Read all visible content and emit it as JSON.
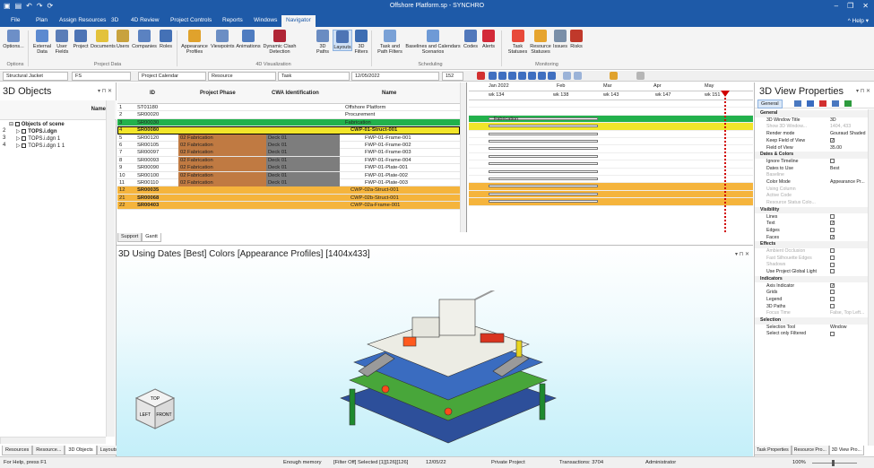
{
  "app": {
    "title": "Offshore Platform.sp - SYNCHRO"
  },
  "menu": {
    "items": [
      "File",
      "Plan",
      "Assign Resources",
      "3D",
      "4D Review",
      "Project Controls",
      "Reports",
      "Windows",
      "Navigator"
    ],
    "active": "Navigator",
    "help": "^ Help ▾"
  },
  "ribbon": {
    "buttons": [
      "Options...",
      "External Data",
      "User Fields",
      "Project",
      "Documents",
      "Users",
      "Companies",
      "Roles",
      "Appearance Profiles",
      "Viewpoints",
      "Animations",
      "Dynamic Clash Detection",
      "3D Paths",
      "Layouts",
      "3D Filters",
      "Task and Path Filters",
      "Baselines and Calendars Scenarios",
      "Codes",
      "Alerts",
      "Task Statuses",
      "Resource Statuses",
      "Issues",
      "Risks"
    ],
    "groups": [
      "Options",
      "Project Data",
      "4D Visualization",
      "Scheduling",
      "Monitoring"
    ]
  },
  "filters": {
    "structure": "Structural Jacket",
    "fs": "FS",
    "calendar": "Project Calendar",
    "resource": "Resource",
    "task": "Task",
    "date": "12/05/2022",
    "zoom": "152"
  },
  "left_panel": {
    "title": "3D Objects",
    "col": "Name",
    "rows": [
      {
        "num": "",
        "name": "Objects of scene"
      },
      {
        "num": "2",
        "name": "TOPS.i.dgn"
      },
      {
        "num": "3",
        "name": "TOPS.i.dgn 1"
      },
      {
        "num": "4",
        "name": "TOPS.i.dgn 1 1"
      }
    ],
    "tabs": [
      "Resources",
      "Resource...",
      "3D Objects",
      "Layouts"
    ],
    "active_tab": "3D Objects"
  },
  "grid": {
    "headers": {
      "id": "ID",
      "phase": "Project Phase",
      "cwa": "CWA Identification",
      "name": "Name"
    },
    "rows": [
      {
        "n": "1",
        "id": "ST01180",
        "phase": "",
        "cwa": "",
        "name": "Offshore Platform",
        "style": "plain"
      },
      {
        "n": "2",
        "id": "SR00020",
        "phase": "",
        "cwa": "",
        "name": "Procurement",
        "style": "plain"
      },
      {
        "n": "3",
        "id": "SR00030",
        "phase": "",
        "cwa": "",
        "name": "Fabrication",
        "style": "green"
      },
      {
        "n": "4",
        "id": "SR00080",
        "phase": "",
        "cwa": "",
        "name": "CWP-01-Struct-001",
        "style": "yellow"
      },
      {
        "n": "5",
        "id": "SR00120",
        "phase": "02 Fabrication",
        "cwa": "Deck 01",
        "name": "FWP-01-Frame-001",
        "style": "task"
      },
      {
        "n": "6",
        "id": "SR00105",
        "phase": "02 Fabrication",
        "cwa": "Deck 01",
        "name": "FWP-01-Frame-002",
        "style": "task"
      },
      {
        "n": "7",
        "id": "SR00097",
        "phase": "02 Fabrication",
        "cwa": "Deck 01",
        "name": "FWP-01-Frame-003",
        "style": "task"
      },
      {
        "n": "8",
        "id": "SR00093",
        "phase": "02 Fabrication",
        "cwa": "Deck 01",
        "name": "FWP-01-Frame-004",
        "style": "task"
      },
      {
        "n": "9",
        "id": "SR00090",
        "phase": "02 Fabrication",
        "cwa": "Deck 01",
        "name": "FWP-01-Plate-001",
        "style": "task"
      },
      {
        "n": "10",
        "id": "SR00100",
        "phase": "02 Fabrication",
        "cwa": "Deck 01",
        "name": "FWP-01-Plate-002",
        "style": "task"
      },
      {
        "n": "11",
        "id": "SR00110",
        "phase": "02 Fabrication",
        "cwa": "Deck 01",
        "name": "FWP-01-Plate-003",
        "style": "task"
      },
      {
        "n": "12",
        "id": "SR00035",
        "phase": "",
        "cwa": "",
        "name": "CWP-02a-Struct-001",
        "style": "orange"
      },
      {
        "n": "21",
        "id": "SR00068",
        "phase": "",
        "cwa": "",
        "name": "CWP-02b-Struct-001",
        "style": "orange"
      },
      {
        "n": "22",
        "id": "SR00403",
        "phase": "",
        "cwa": "",
        "name": "CWP-02a-Frame-001",
        "style": "orange"
      }
    ],
    "tabs": [
      "Support",
      "Gantt"
    ],
    "active_tab": "Gantt"
  },
  "gantt": {
    "months": [
      "Jan 2022",
      "Feb",
      "Mar",
      "Apr",
      "May"
    ],
    "weeks": [
      "wk 134",
      "wk 138",
      "wk 143",
      "wk 147",
      "wk 151"
    ],
    "bar_label": "Fabrication"
  },
  "view3d": {
    "title": "3D Using Dates [Best] Colors [Appearance Profiles]  [1404x433]",
    "cube": {
      "top": "TOP",
      "left": "LEFT",
      "front": "FRONT"
    }
  },
  "right_panel": {
    "title": "3D View Properties",
    "tabs": [
      "General"
    ],
    "rows": [
      {
        "k": "General",
        "v": "",
        "sec": true
      },
      {
        "k": "3D Window Title",
        "v": "3D"
      },
      {
        "k": "Show 3D Window...",
        "v": "1404, 433",
        "dim": true
      },
      {
        "k": "Render mode",
        "v": "Gouraud Shaded"
      },
      {
        "k": "Keep Field of View",
        "v": "",
        "chk": true,
        "on": true
      },
      {
        "k": "Field of View",
        "v": "35.00"
      },
      {
        "k": "Dates & Colors",
        "v": "",
        "sec": true
      },
      {
        "k": "Ignore Timeline",
        "v": "",
        "chk": true
      },
      {
        "k": "Dates to Use",
        "v": "Best"
      },
      {
        "k": "Baseline",
        "v": "",
        "dim": true
      },
      {
        "k": "Color Mode",
        "v": "Appearance Pr..."
      },
      {
        "k": "Using Column",
        "v": "",
        "dim": true
      },
      {
        "k": "Active Code",
        "v": "",
        "dim": true
      },
      {
        "k": "Resource Status Colo...",
        "v": "",
        "dim": true
      },
      {
        "k": "Visibility",
        "v": "",
        "sec": true
      },
      {
        "k": "Lines",
        "v": "",
        "chk": true
      },
      {
        "k": "Text",
        "v": "",
        "chk": true,
        "on": true
      },
      {
        "k": "Edges",
        "v": "",
        "chk": true
      },
      {
        "k": "Faces",
        "v": "",
        "chk": true,
        "on": true
      },
      {
        "k": "Effects",
        "v": "",
        "sec": true
      },
      {
        "k": "Ambient Occlusion",
        "v": "",
        "chk": true,
        "dim": true
      },
      {
        "k": "Fast Silhouette Edges",
        "v": "",
        "chk": true,
        "dim": true
      },
      {
        "k": "Shadows",
        "v": "",
        "chk": true,
        "dim": true
      },
      {
        "k": "Use Project Global Light",
        "v": "",
        "chk": true
      },
      {
        "k": "Indicators",
        "v": "",
        "sec": true
      },
      {
        "k": "Axis Indicator",
        "v": "",
        "chk": true,
        "on": true
      },
      {
        "k": "Grids",
        "v": "",
        "chk": true
      },
      {
        "k": "Legend",
        "v": "",
        "chk": true
      },
      {
        "k": "3D Paths",
        "v": "",
        "chk": true
      },
      {
        "k": "Focus Time",
        "v": "False, Top Left...",
        "dim": true
      },
      {
        "k": "Selection",
        "v": "",
        "sec": true
      },
      {
        "k": "Selection Tool",
        "v": "Window"
      },
      {
        "k": "Select only Filtered",
        "v": "",
        "chk": true
      }
    ],
    "bottom_tabs": [
      "Task Properties",
      "Resource Pro...",
      "3D View Pro..."
    ],
    "active_tab": "3D View Pro..."
  },
  "status": {
    "help": "For Help, press F1",
    "memory": "Enough memory",
    "filter": "[Filter Off]  Selected [1][126][126]",
    "date": "12/05/22",
    "project": "Private Project",
    "transactions": "Transactions: 3704",
    "user": "Administrator",
    "zoom": "100%"
  },
  "colors": {
    "titlebar": "#1e5aa8",
    "green": "#22b14c",
    "yellow": "#f2e52a",
    "orange": "#f5b43c",
    "brown": "#c07a42",
    "gray": "#7d7d7d",
    "accent": "#d10000"
  }
}
